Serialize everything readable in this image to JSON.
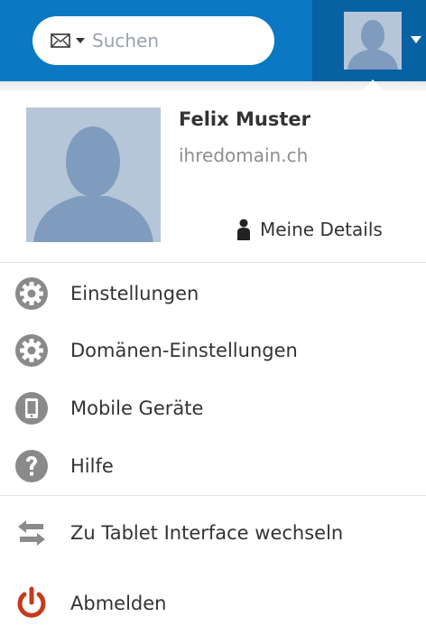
{
  "search": {
    "placeholder": "Suchen"
  },
  "user": {
    "name": "Felix Muster",
    "domain": "ihredomain.ch",
    "details_label": "Meine Details"
  },
  "menu": {
    "settings": "Einstellungen",
    "domain_settings": "Domänen-Einstellungen",
    "mobile_devices": "Mobile Geräte",
    "help": "Hilfe",
    "tablet_switch": "Zu Tablet Interface wechseln",
    "logout": "Abmelden"
  },
  "colors": {
    "topbar": "#0a78c2",
    "topbar_dark": "#0861a3",
    "icon_gray": "#8a8a8a",
    "logout_red": "#c43b1c"
  }
}
